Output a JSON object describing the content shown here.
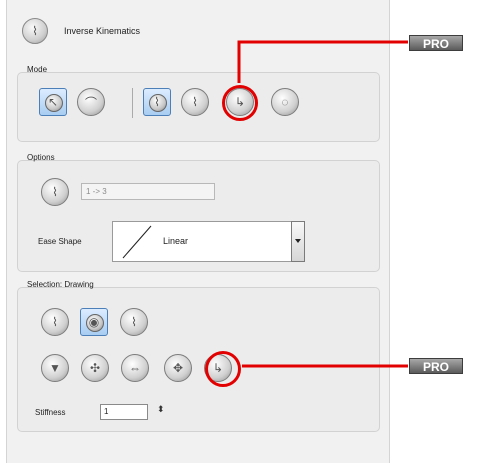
{
  "header": {
    "title": "Inverse Kinematics",
    "icon": "ik-tool-icon"
  },
  "mode": {
    "label": "Mode",
    "buttons": [
      "select-bone-tool",
      "bone-tool",
      "ik-manipulation-tool",
      "ik-chain-tool",
      "ik-transform-tool",
      "ik-pin-tool"
    ],
    "selected": "ik-manipulation-tool"
  },
  "options": {
    "label": "Options",
    "range_value": "1 -> 3",
    "ease_shape_label": "Ease Shape",
    "ease_shape_value": "Linear"
  },
  "selection": {
    "label": "Selection: Drawing",
    "row1": [
      "select-parent",
      "select-current",
      "select-child"
    ],
    "row2": [
      "hip-bone",
      "rotate-constraint",
      "translate-constraint",
      "scale-constraint",
      "ik-constraint"
    ],
    "selected": "select-current",
    "stiffness_label": "Stiffness",
    "stiffness_value": "1"
  },
  "callouts": {
    "top": "PRO",
    "bottom": "PRO"
  },
  "colors": {
    "callout": "#e30000",
    "selected_blue": "#a8cdf1"
  }
}
